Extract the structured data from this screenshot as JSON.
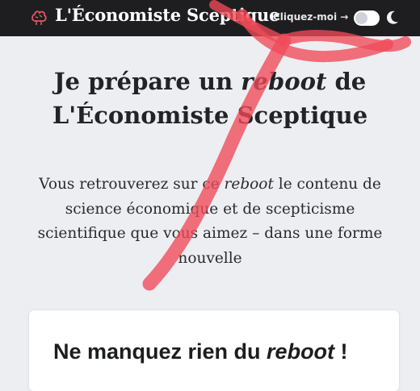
{
  "header": {
    "site_title": "L'Économiste Sceptique",
    "cta_text": "Cliquez-moi →",
    "theme_toggle": {
      "state": "off"
    },
    "icons": {
      "logo": "brain-logo-icon",
      "moon": "moon-icon"
    }
  },
  "hero": {
    "headline_before": "Je prépare un ",
    "headline_em": "reboot",
    "headline_after": " de L'Économiste Sceptique",
    "subtitle_before": "Vous retrouverez sur ce ",
    "subtitle_em": "reboot",
    "subtitle_after": " le contenu de science économique et de scepticisme scientifique que vous aimez – dans une forme nouvelle"
  },
  "signup_card": {
    "title_before": "Ne manquez rien du ",
    "title_em": "reboot",
    "title_after": " !"
  },
  "colors": {
    "topbar": "#1e1e20",
    "page_bg": "#eceef2",
    "scribble": "#f04a58"
  }
}
